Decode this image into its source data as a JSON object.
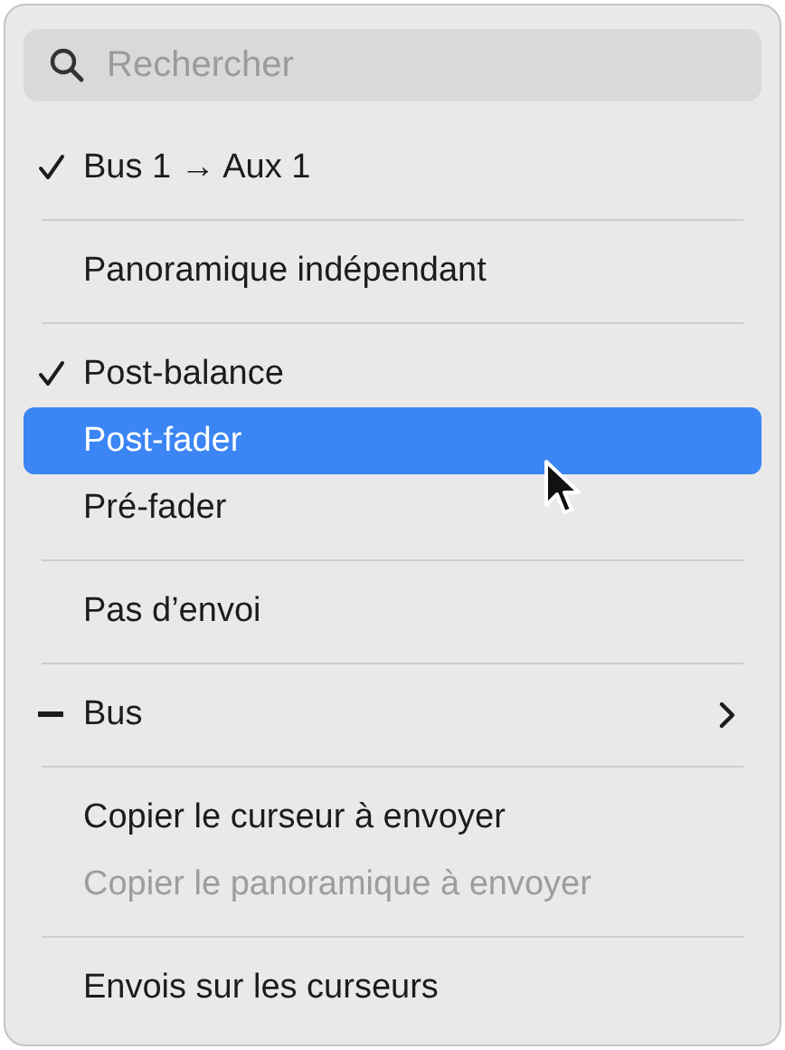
{
  "search": {
    "placeholder": "Rechercher"
  },
  "items": [
    {
      "kind": "item",
      "label": "Bus 1 → Aux 1",
      "checked": true,
      "mixed": false,
      "selected": false,
      "disabled": false,
      "submenu": false
    },
    {
      "kind": "separator"
    },
    {
      "kind": "item",
      "label": "Panoramique indépendant",
      "checked": false,
      "mixed": false,
      "selected": false,
      "disabled": false,
      "submenu": false
    },
    {
      "kind": "separator"
    },
    {
      "kind": "item",
      "label": "Post-balance",
      "checked": true,
      "mixed": false,
      "selected": false,
      "disabled": false,
      "submenu": false
    },
    {
      "kind": "item",
      "label": "Post-fader",
      "checked": false,
      "mixed": false,
      "selected": true,
      "disabled": false,
      "submenu": false
    },
    {
      "kind": "item",
      "label": "Pré-fader",
      "checked": false,
      "mixed": false,
      "selected": false,
      "disabled": false,
      "submenu": false
    },
    {
      "kind": "separator"
    },
    {
      "kind": "item",
      "label": "Pas d’envoi",
      "checked": false,
      "mixed": false,
      "selected": false,
      "disabled": false,
      "submenu": false
    },
    {
      "kind": "separator"
    },
    {
      "kind": "item",
      "label": "Bus",
      "checked": false,
      "mixed": true,
      "selected": false,
      "disabled": false,
      "submenu": true
    },
    {
      "kind": "separator"
    },
    {
      "kind": "item",
      "label": "Copier le curseur à envoyer",
      "checked": false,
      "mixed": false,
      "selected": false,
      "disabled": false,
      "submenu": false
    },
    {
      "kind": "item",
      "label": "Copier le panoramique à envoyer",
      "checked": false,
      "mixed": false,
      "selected": false,
      "disabled": true,
      "submenu": false
    },
    {
      "kind": "separator"
    },
    {
      "kind": "item",
      "label": "Envois sur les curseurs",
      "checked": false,
      "mixed": false,
      "selected": false,
      "disabled": false,
      "submenu": false
    }
  ]
}
